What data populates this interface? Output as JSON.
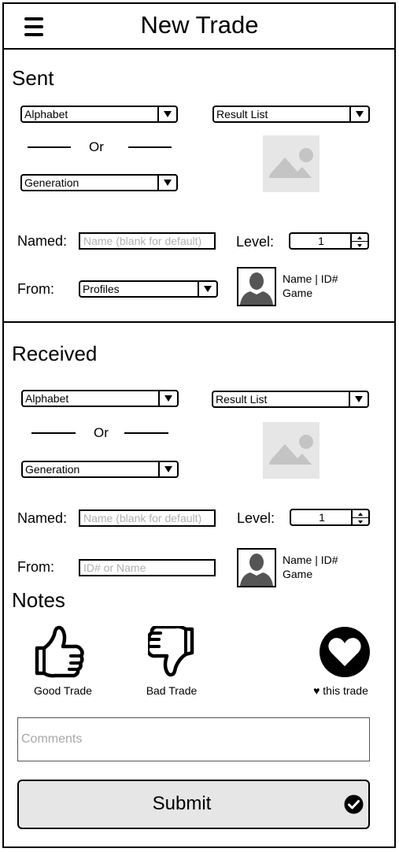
{
  "header": {
    "title": "New Trade"
  },
  "sent": {
    "title": "Sent",
    "alphabet_select": "Alphabet",
    "result_select": "Result List",
    "or": "Or",
    "generation_select": "Generation",
    "named_label": "Named:",
    "named_placeholder": "Name (blank for default)",
    "level_label": "Level:",
    "level_value": "1",
    "from_label": "From:",
    "from_select": "Profiles",
    "profile_name": "Name | ID#",
    "profile_game": "Game"
  },
  "received": {
    "title": "Received",
    "alphabet_select": "Alphabet",
    "result_select": "Result List",
    "or": "Or",
    "generation_select": "Generation",
    "named_label": "Named:",
    "named_placeholder": "Name (blank for default)",
    "level_label": "Level:",
    "level_value": "1",
    "from_label": "From:",
    "from_placeholder": "ID# or Name",
    "profile_name": "Name | ID#",
    "profile_game": "Game"
  },
  "notes": {
    "title": "Notes",
    "good_label": "Good Trade",
    "bad_label": "Bad Trade",
    "love_label": "♥ this trade",
    "comments_placeholder": "Comments",
    "submit_label": "Submit"
  },
  "icons": {
    "menu": "hamburger-menu-icon",
    "thumbs_up": "thumbs-up-icon",
    "thumbs_down": "thumbs-down-icon",
    "heart": "heart-icon",
    "check": "check-circle-icon",
    "image": "image-placeholder-icon",
    "avatar": "person-silhouette-icon"
  },
  "colors": {
    "placeholder_bg": "#e6e6e6",
    "button_bg": "#e6e6e6",
    "border": "#000000"
  }
}
